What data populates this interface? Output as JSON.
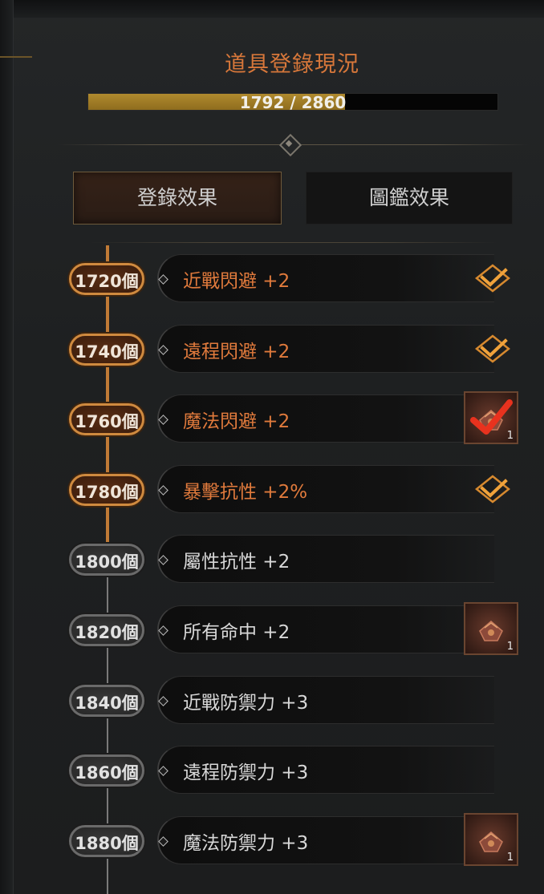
{
  "header": {
    "title": "道具登錄現況",
    "progress_text": "1792 / 2860",
    "progress_fraction": 0.627
  },
  "tabs": [
    {
      "label": "登錄效果",
      "active": true
    },
    {
      "label": "圖鑑效果",
      "active": false
    }
  ],
  "milestones": [
    {
      "count": "1720個",
      "effect": "近戰閃避 +2",
      "achieved": true,
      "marker": "check-icon"
    },
    {
      "count": "1740個",
      "effect": "遠程閃避 +2",
      "achieved": true,
      "marker": "check-icon"
    },
    {
      "count": "1760個",
      "effect": "魔法閃避 +2",
      "achieved": true,
      "marker": "reward-claimed",
      "reward_qty": "1"
    },
    {
      "count": "1780個",
      "effect": "暴擊抗性 +2%",
      "achieved": true,
      "marker": "check-icon"
    },
    {
      "count": "1800個",
      "effect": "屬性抗性 +2",
      "achieved": false,
      "marker": "none"
    },
    {
      "count": "1820個",
      "effect": "所有命中 +2",
      "achieved": false,
      "marker": "reward",
      "reward_qty": "1"
    },
    {
      "count": "1840個",
      "effect": "近戰防禦力 +3",
      "achieved": false,
      "marker": "none"
    },
    {
      "count": "1860個",
      "effect": "遠程防禦力 +3",
      "achieved": false,
      "marker": "none"
    },
    {
      "count": "1880個",
      "effect": "魔法防禦力 +3",
      "achieved": false,
      "marker": "reward",
      "reward_qty": "1"
    }
  ],
  "colors": {
    "accent_orange": "#e07a3c",
    "achieved_ring": "#cf8a3f",
    "progress_gold": "#b08a2e",
    "check_red": "#e8321e"
  }
}
